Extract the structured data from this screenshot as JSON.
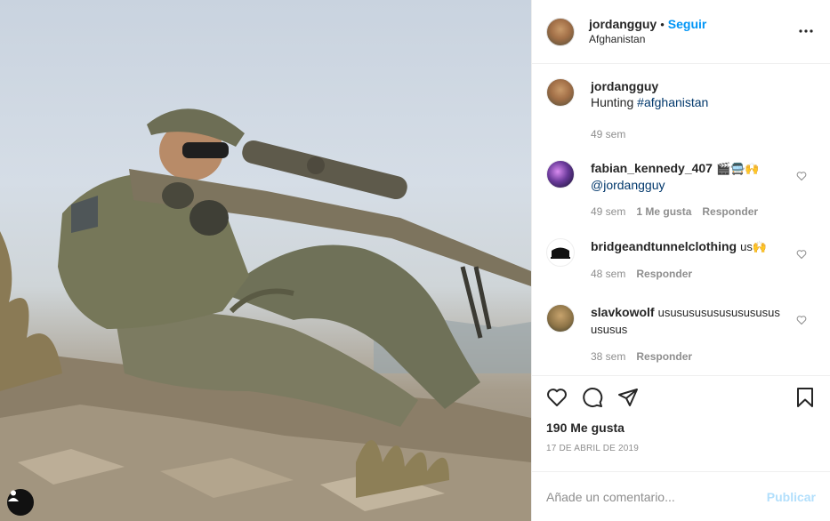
{
  "header": {
    "username": "jordangguy",
    "separator": "•",
    "follow_label": "Seguir",
    "location": "Afghanistan"
  },
  "caption": {
    "username": "jordangguy",
    "text": "Hunting ",
    "hashtag": "#afghanistan",
    "time": "49 sem"
  },
  "comments": [
    {
      "username": "fabian_kennedy_407",
      "text": "🎬🚍🙌",
      "mention": "@jordangguy",
      "time": "49 sem",
      "likes": "1 Me gusta",
      "reply": "Responder"
    },
    {
      "username": "bridgeandtunnelclothing",
      "text": "us🙌",
      "time": "48 sem",
      "reply": "Responder"
    },
    {
      "username": "slavkowolf",
      "text": "usususususususususus ususus",
      "time": "38 sem",
      "reply": "Responder"
    }
  ],
  "stats": {
    "likes": "190 Me gusta",
    "date": "17 DE ABRIL DE 2019"
  },
  "composer": {
    "placeholder": "Añade un comentario...",
    "publish_label": "Publicar"
  },
  "icons": {
    "like": "heart-icon",
    "comment": "comment-bubble-icon",
    "share": "paper-plane-icon",
    "save": "bookmark-icon",
    "more": "more-options-icon",
    "tag": "user-tag-icon"
  },
  "colors": {
    "accent": "#0095f6",
    "link": "#00376b",
    "muted": "#8e8e8e",
    "publish_disabled": "#b2dffc"
  }
}
